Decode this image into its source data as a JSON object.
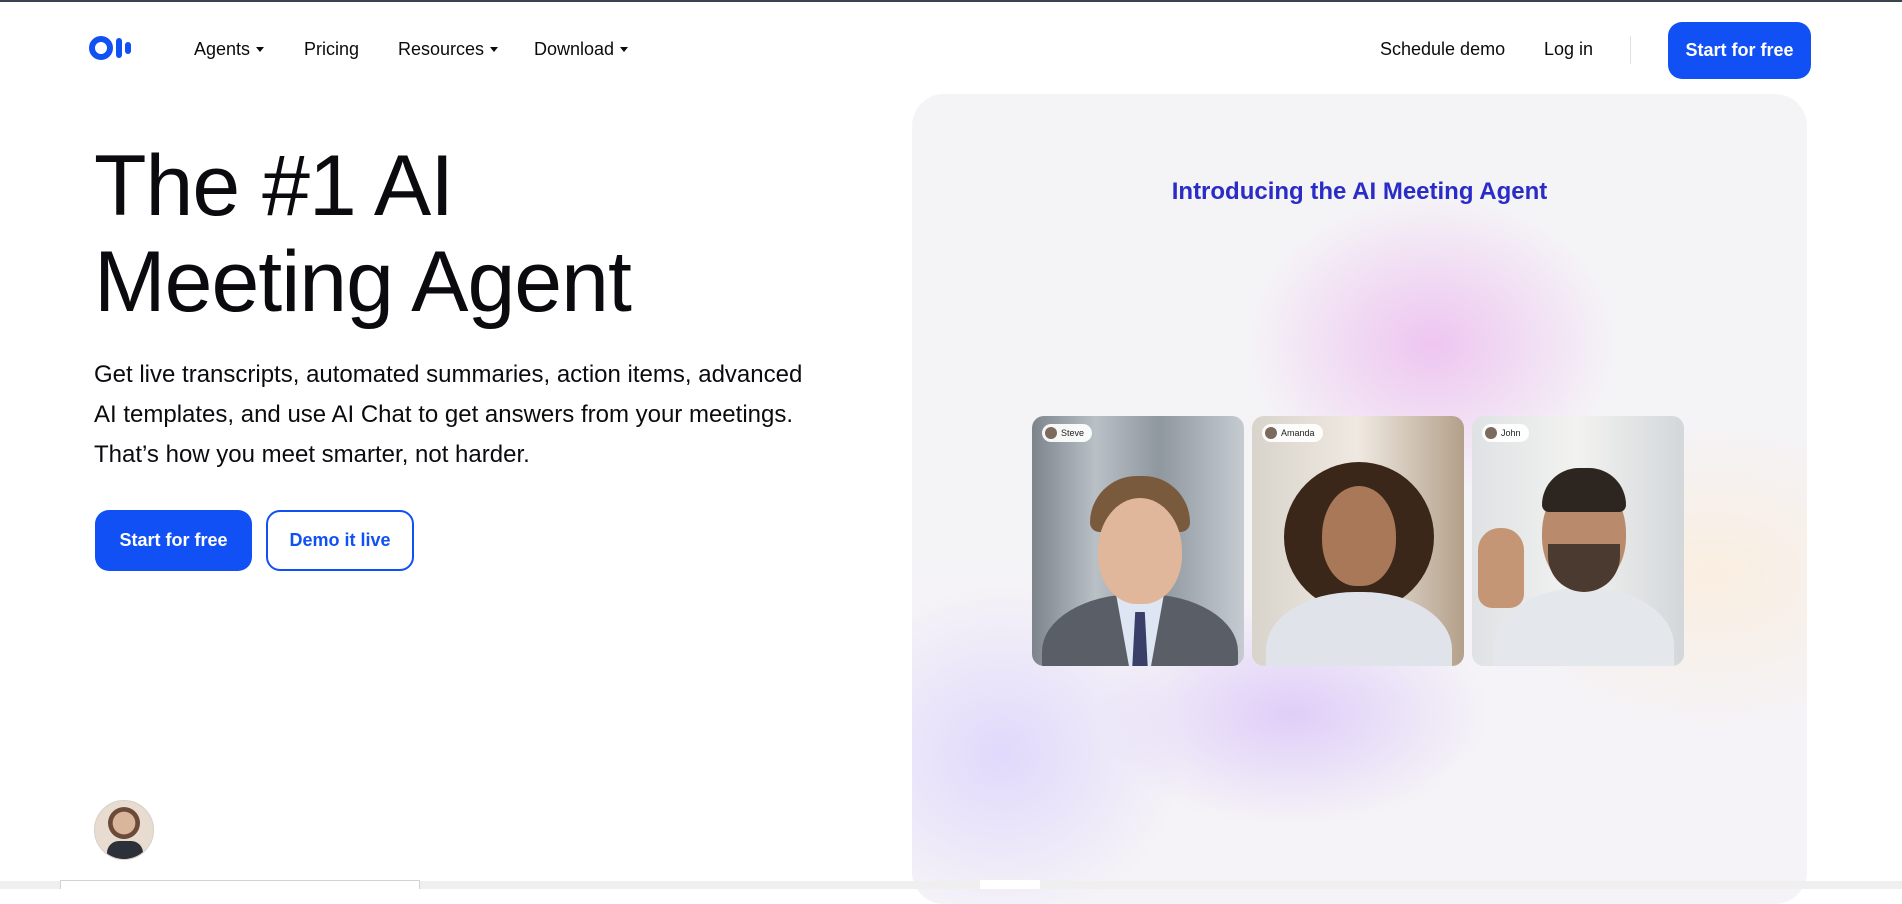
{
  "nav": {
    "logo_alt": "Otter",
    "items": [
      {
        "label": "Agents",
        "has_caret": true
      },
      {
        "label": "Pricing",
        "has_caret": false
      },
      {
        "label": "Resources",
        "has_caret": true
      },
      {
        "label": "Download",
        "has_caret": true
      }
    ],
    "schedule_demo": "Schedule demo",
    "login": "Log in",
    "cta": "Start for free"
  },
  "hero": {
    "title_line1": "The #1 AI",
    "title_line2": "Meeting Agent",
    "subtitle_line1": "Get live transcripts, automated summaries, action items, advanced",
    "subtitle_line2": "AI templates, and use AI Chat to get answers from your meetings.",
    "subtitle_line3": "That’s how you meet smarter, not harder.",
    "primary_button": "Start for free",
    "secondary_button": "Demo it live"
  },
  "video": {
    "heading": "Introducing the AI Meeting Agent",
    "participants": [
      "Steve",
      "Amanda",
      "John"
    ]
  },
  "colors": {
    "brand": "#1150f5",
    "heading_accent": "#2a2cc8",
    "text": "#0b0b0f"
  }
}
